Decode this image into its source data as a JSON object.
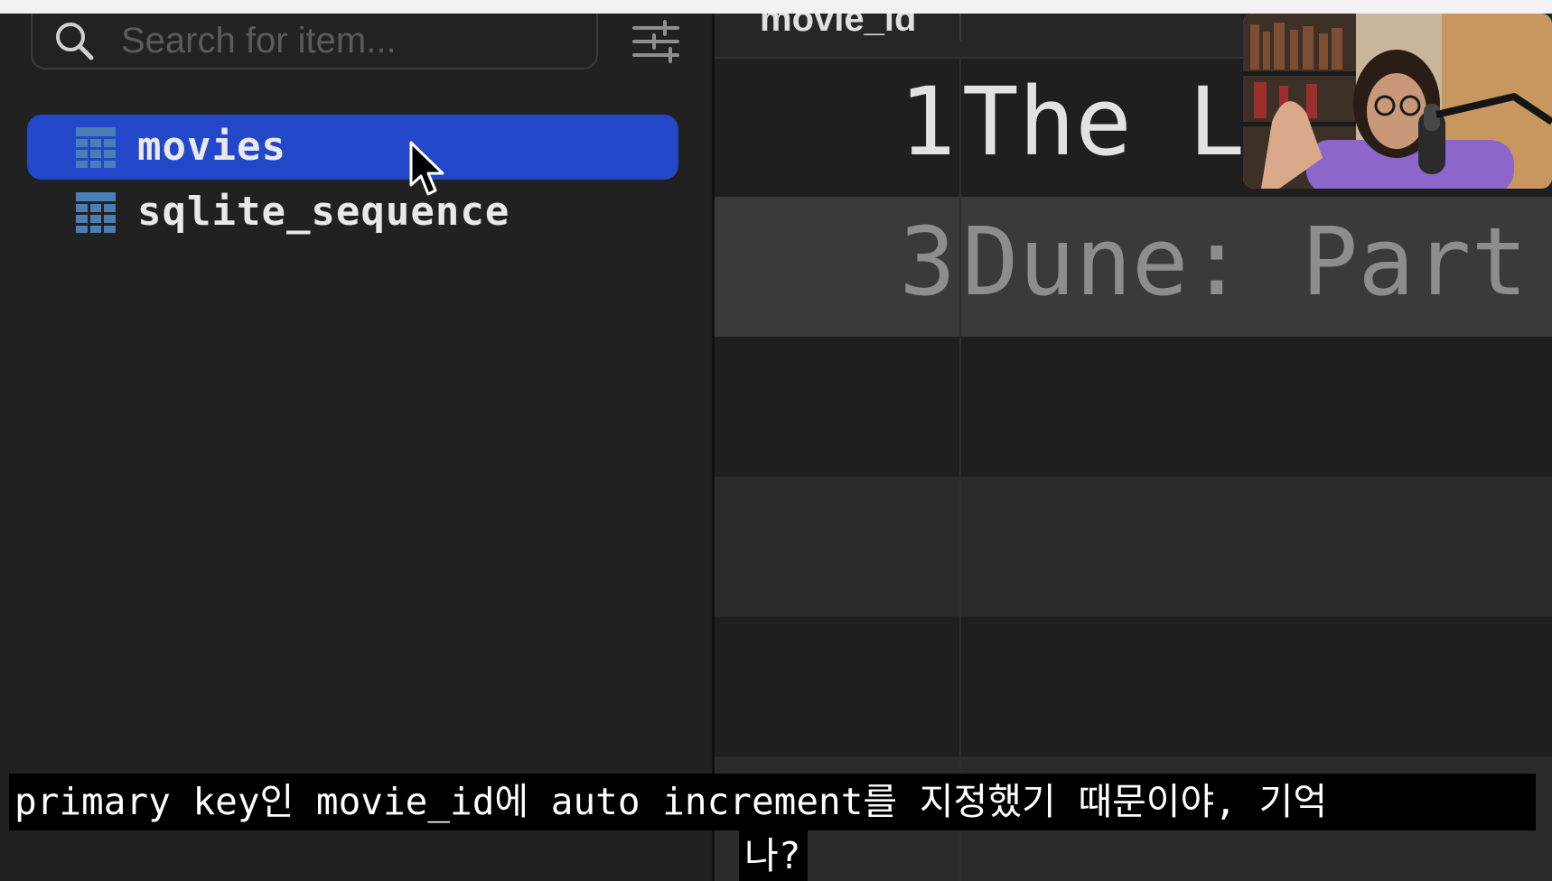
{
  "sidebar": {
    "search": {
      "placeholder": "Search for item..."
    },
    "items": [
      {
        "label": "movies",
        "selected": true,
        "icon": "table-icon"
      },
      {
        "label": "sqlite_sequence",
        "selected": false,
        "icon": "table-icon"
      }
    ]
  },
  "grid": {
    "columns": [
      "movie_id"
    ],
    "rows": [
      {
        "movie_id": "1",
        "title": "The L"
      },
      {
        "movie_id": "3",
        "title": "Dune: Part"
      }
    ]
  },
  "subtitle": {
    "line1": "primary key인 movie_id에 auto increment를 지정했기 때문이야, 기억",
    "line2": "나?"
  },
  "colors": {
    "selection": "#2248c9",
    "sidebar_bg": "#212121",
    "table_icon": "#4a7fb6"
  }
}
